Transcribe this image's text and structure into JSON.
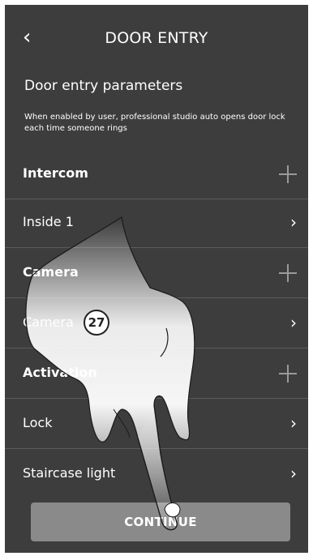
{
  "header": {
    "title": "DOOR ENTRY",
    "back_icon": "chevron-left-icon"
  },
  "params": {
    "title": "Door entry parameters",
    "description": "When enabled by user, professional studio auto opens door lock each time someone rings"
  },
  "rows": [
    {
      "label": "Intercom",
      "type": "section",
      "icon": "plus-icon"
    },
    {
      "label": "Inside 1",
      "type": "item",
      "icon": "chevron-right-icon"
    },
    {
      "label": "Camera",
      "type": "section",
      "icon": "plus-icon"
    },
    {
      "label": "Camera",
      "type": "item",
      "icon": "chevron-right-icon"
    },
    {
      "label": "Activation",
      "type": "section",
      "icon": "plus-icon"
    },
    {
      "label": "Lock",
      "type": "item",
      "icon": "chevron-right-icon"
    },
    {
      "label": "Staircase light",
      "type": "item",
      "icon": "chevron-right-icon"
    }
  ],
  "continue_label": "CONTINUE",
  "callout": {
    "number": "27"
  }
}
